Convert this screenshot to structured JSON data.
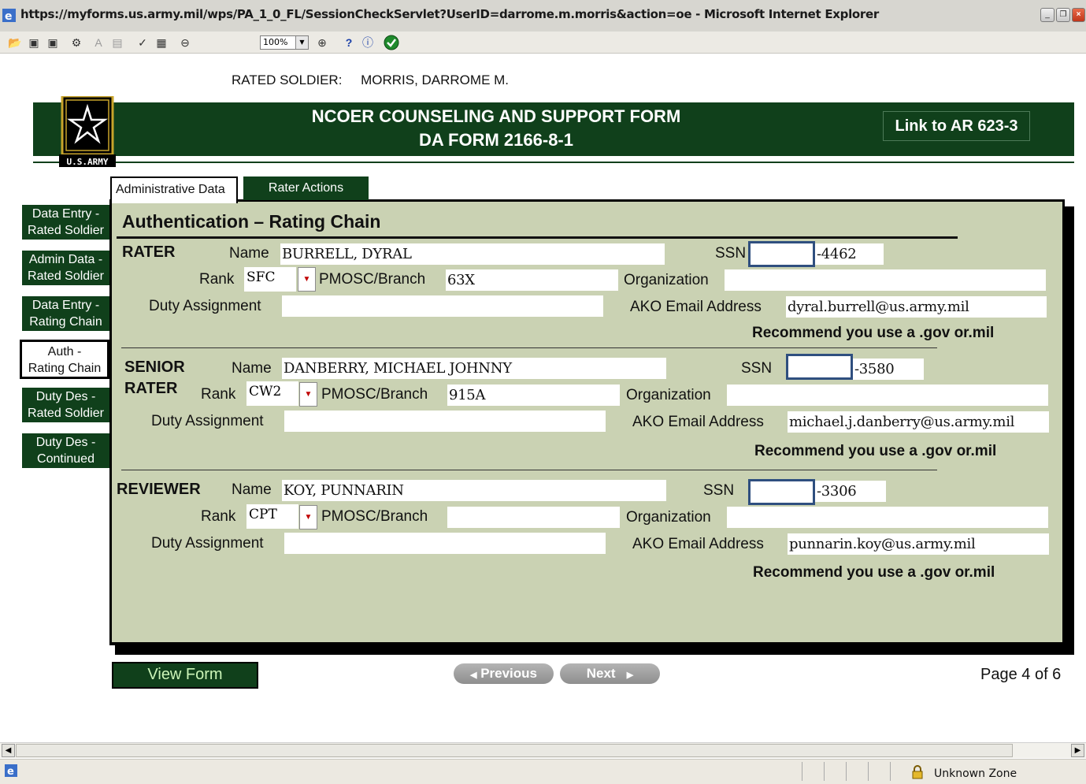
{
  "window": {
    "title": "https://myforms.us.army.mil/wps/PA_1_0_FL/SessionCheckServlet?UserID=darrome.m.morris&action=oe - Microsoft Internet Explorer"
  },
  "toolbar": {
    "zoom": "100%"
  },
  "header": {
    "rated_soldier_label": "RATED SOLDIER:",
    "rated_soldier_name": "MORRIS, DARROME M.",
    "form_title_1": "NCOER COUNSELING AND SUPPORT FORM",
    "form_title_2": "DA FORM 2166-8-1",
    "ar_link": "Link to AR 623-3",
    "logo_text": "U.S.ARMY"
  },
  "tabs": [
    {
      "label": "Administrative Data"
    },
    {
      "label": "Rater Actions"
    }
  ],
  "sidebar": {
    "items": [
      {
        "line1": "Data Entry -",
        "line2": "Rated Soldier"
      },
      {
        "line1": "Admin Data -",
        "line2": "Rated Soldier"
      },
      {
        "line1": "Data Entry -",
        "line2": "Rating Chain"
      },
      {
        "line1": "Auth -",
        "line2": "Rating Chain"
      },
      {
        "line1": "Duty Des -",
        "line2": "Rated Soldier"
      },
      {
        "line1": "Duty Des -",
        "line2": "Continued"
      }
    ]
  },
  "panel": {
    "heading": "Authentication – Rating Chain"
  },
  "labels": {
    "name": "Name",
    "ssn": "SSN",
    "rank": "Rank",
    "pmosc": "PMOSC/Branch",
    "organization": "Organization",
    "duty": "Duty Assignment",
    "ako": "AKO Email Address",
    "recommend": "Recommend you use a .gov or.mil"
  },
  "rater": {
    "role": "RATER",
    "name": "BURRELL, DYRAL",
    "ssn_suffix": "-4462",
    "rank": "SFC",
    "pmosc": "63X",
    "organization": "",
    "duty": "",
    "email": "dyral.burrell@us.army.mil"
  },
  "senior_rater": {
    "role_line1": "SENIOR",
    "role_line2": "RATER",
    "name": "DANBERRY, MICHAEL JOHNNY",
    "ssn_suffix": "-3580",
    "rank": "CW2",
    "pmosc": "915A",
    "organization": "",
    "duty": "",
    "email": "michael.j.danberry@us.army.mil"
  },
  "reviewer": {
    "role": "REVIEWER",
    "name": "KOY, PUNNARIN",
    "ssn_suffix": "-3306",
    "rank": "CPT",
    "pmosc": "",
    "organization": "",
    "duty": "",
    "email": "punnarin.koy@us.army.mil"
  },
  "footer": {
    "view_form": "View Form",
    "previous": "Previous",
    "next": "Next",
    "page": "Page 4 of 6"
  },
  "status": {
    "zone": "Unknown Zone"
  }
}
